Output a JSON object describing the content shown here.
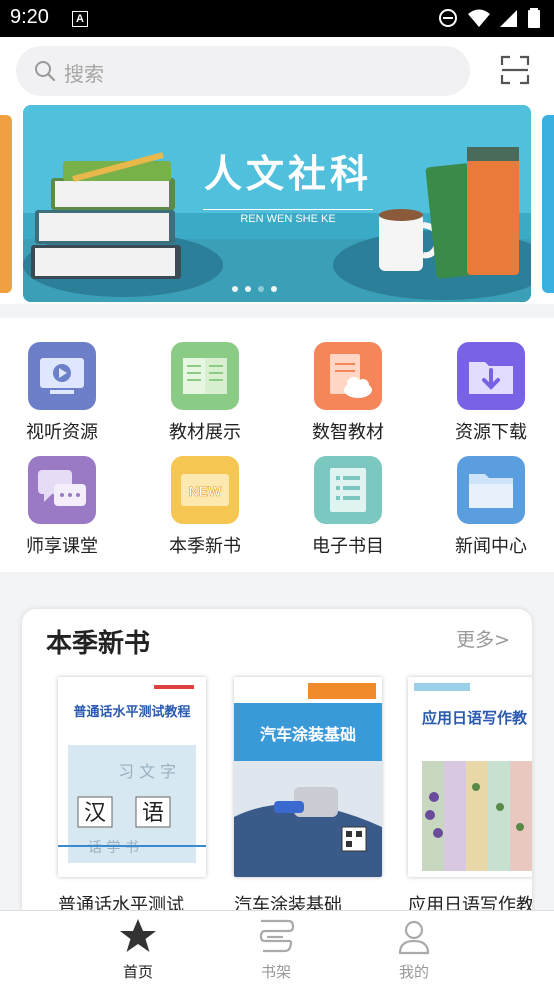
{
  "status_bar": {
    "time": "9:20"
  },
  "search": {
    "placeholder": "搜索"
  },
  "banner": {
    "title": "人文社科",
    "subtitle": "REN WEN SHE KE",
    "slides": 4,
    "active_slide": 1
  },
  "grid": {
    "items": [
      {
        "label": "视听资源",
        "icon": "video-icon",
        "color": "#6c7fc8"
      },
      {
        "label": "教材展示",
        "icon": "open-book-icon",
        "color": "#8acb86"
      },
      {
        "label": "数智教材",
        "icon": "cloud-doc-icon",
        "color": "#f4865a"
      },
      {
        "label": "资源下载",
        "icon": "download-folder-icon",
        "color": "#7a62e6"
      },
      {
        "label": "师享课堂",
        "icon": "chat-icon",
        "color": "#9a7ac4"
      },
      {
        "label": "本季新书",
        "icon": "new-badge-icon",
        "color": "#f6c653"
      },
      {
        "label": "电子书目",
        "icon": "list-icon",
        "color": "#7ac8c0"
      },
      {
        "label": "新闻中心",
        "icon": "folder-icon",
        "color": "#5a9ee0"
      }
    ]
  },
  "new_books": {
    "title": "本季新书",
    "more": "更多>",
    "books": [
      {
        "name": "普通话水平测试",
        "cover_title": "普通话水平测试教程"
      },
      {
        "name": "汽车涂装基础",
        "cover_title": "汽车涂装基础"
      },
      {
        "name": "应用日语写作教",
        "cover_title": "应用日语写作教"
      }
    ]
  },
  "tabbar": {
    "tabs": [
      {
        "label": "首页",
        "icon": "star-icon",
        "active": true
      },
      {
        "label": "书架",
        "icon": "bookshelf-icon",
        "active": false
      },
      {
        "label": "我的",
        "icon": "user-icon",
        "active": false
      }
    ]
  }
}
